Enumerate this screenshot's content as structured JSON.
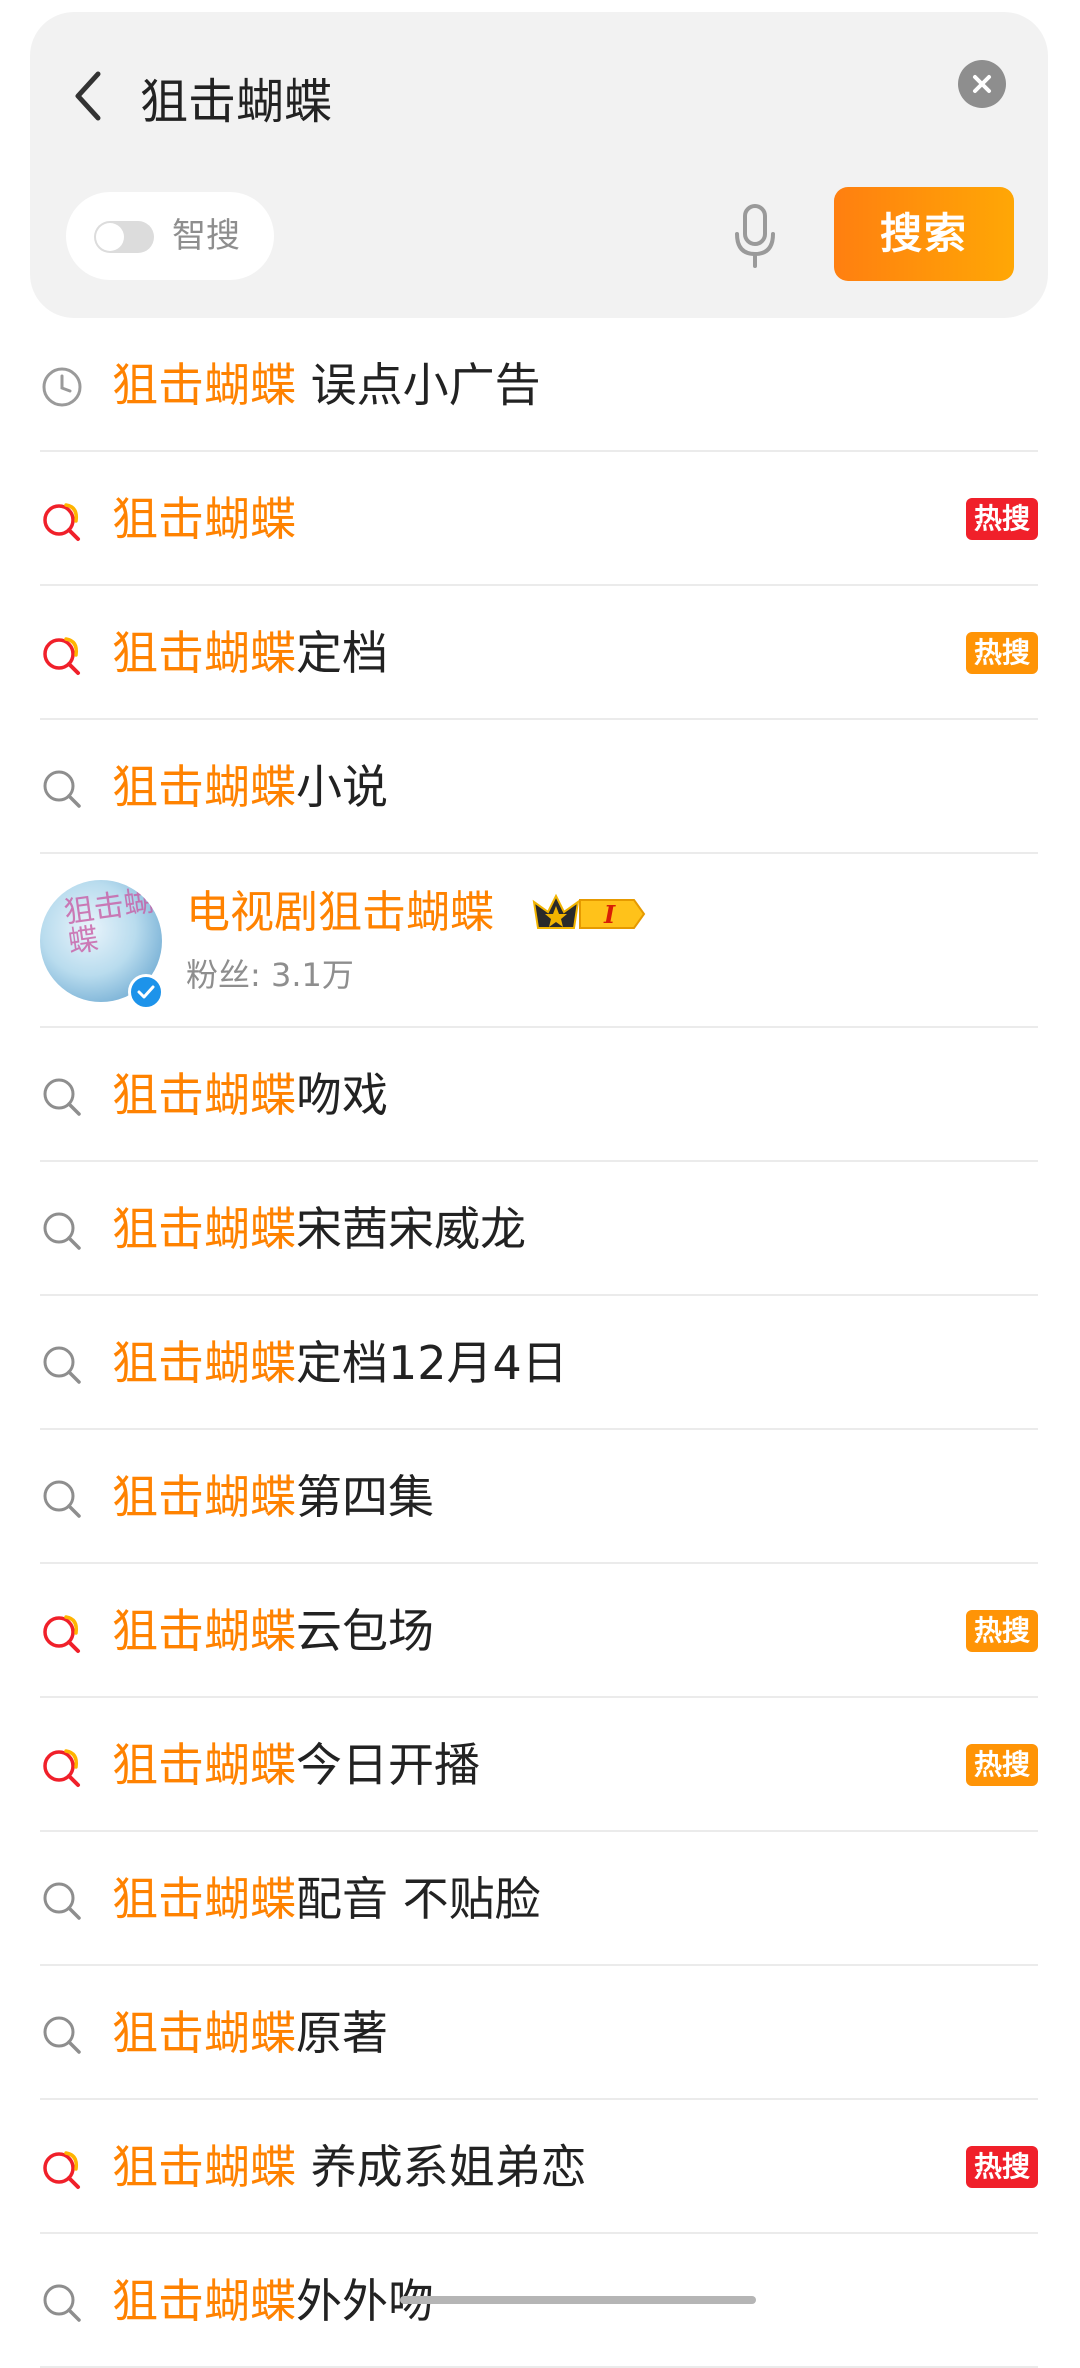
{
  "search": {
    "query": "狙击蝴蝶",
    "smart_search_label": "智搜",
    "search_button_label": "搜索"
  },
  "suggestions": [
    {
      "type": "history",
      "highlight": "狙击蝴蝶",
      "rest": " 误点小广告",
      "badge": null
    },
    {
      "type": "hot",
      "highlight": "狙击蝴蝶",
      "rest": "",
      "badge": {
        "label": "热搜",
        "color": "#f0202a"
      }
    },
    {
      "type": "hot",
      "highlight": "狙击蝴蝶",
      "rest": "定档",
      "badge": {
        "label": "热搜",
        "color": "#ff9406"
      }
    },
    {
      "type": "search",
      "highlight": "狙击蝴蝶",
      "rest": "小说",
      "badge": null
    },
    {
      "type": "search",
      "highlight": "狙击蝴蝶",
      "rest": "吻戏",
      "badge": null
    },
    {
      "type": "search",
      "highlight": "狙击蝴蝶",
      "rest": "宋茜宋威龙",
      "badge": null
    },
    {
      "type": "search",
      "highlight": "狙击蝴蝶",
      "rest": "定档12月4日",
      "badge": null
    },
    {
      "type": "search",
      "highlight": "狙击蝴蝶",
      "rest": "第四集",
      "badge": null
    },
    {
      "type": "hot",
      "highlight": "狙击蝴蝶",
      "rest": "云包场",
      "badge": {
        "label": "热搜",
        "color": "#ff9406"
      }
    },
    {
      "type": "hot",
      "highlight": "狙击蝴蝶",
      "rest": "今日开播",
      "badge": {
        "label": "热搜",
        "color": "#ff9406"
      }
    },
    {
      "type": "search",
      "highlight": "狙击蝴蝶",
      "rest": "配音 不贴脸",
      "badge": null
    },
    {
      "type": "search",
      "highlight": "狙击蝴蝶",
      "rest": "原著",
      "badge": null
    },
    {
      "type": "hot",
      "highlight": "狙击蝴蝶",
      "rest": " 养成系姐弟恋",
      "badge": {
        "label": "热搜",
        "color": "#f0202a"
      }
    },
    {
      "type": "search",
      "highlight": "狙击蝴蝶",
      "rest": "外外吻",
      "badge": null
    }
  ],
  "user_result": {
    "name": "电视剧狙击蝴蝶",
    "fans": "粉丝: 3.1万",
    "level_badge": "I",
    "avatar_art": "狙击蝴蝶"
  },
  "colors": {
    "accent": "#ff8200",
    "hot_red": "#f0202a",
    "hot_orange": "#ff9406"
  },
  "icons": {
    "back": "chevron-left-icon",
    "clear": "close-icon",
    "mic": "microphone-icon",
    "history": "clock-icon",
    "hot": "hot-search-icon",
    "search": "search-icon",
    "verified": "verified-icon",
    "crown": "crown-level-icon"
  }
}
